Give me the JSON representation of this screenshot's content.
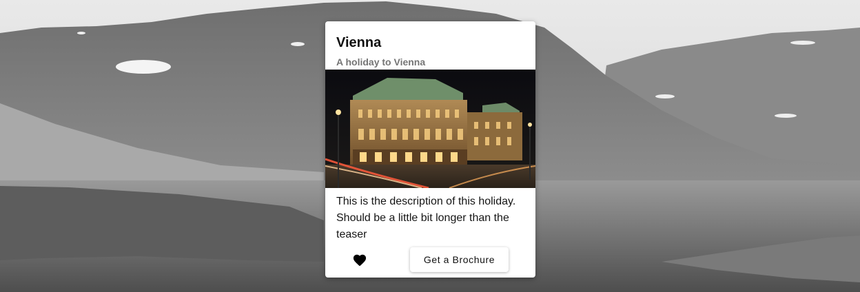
{
  "card": {
    "title": "Vienna",
    "subtitle": "A holiday to Vienna",
    "image_alt": "Vienna State Opera at night",
    "description": "This is the description of this holiday. Should be a little bit longer than the teaser",
    "favorite_icon": "heart-icon",
    "brochure_label": "Get a Brochure"
  },
  "colors": {
    "card_bg": "#ffffff",
    "title": "#111111",
    "subtitle": "#757575"
  }
}
